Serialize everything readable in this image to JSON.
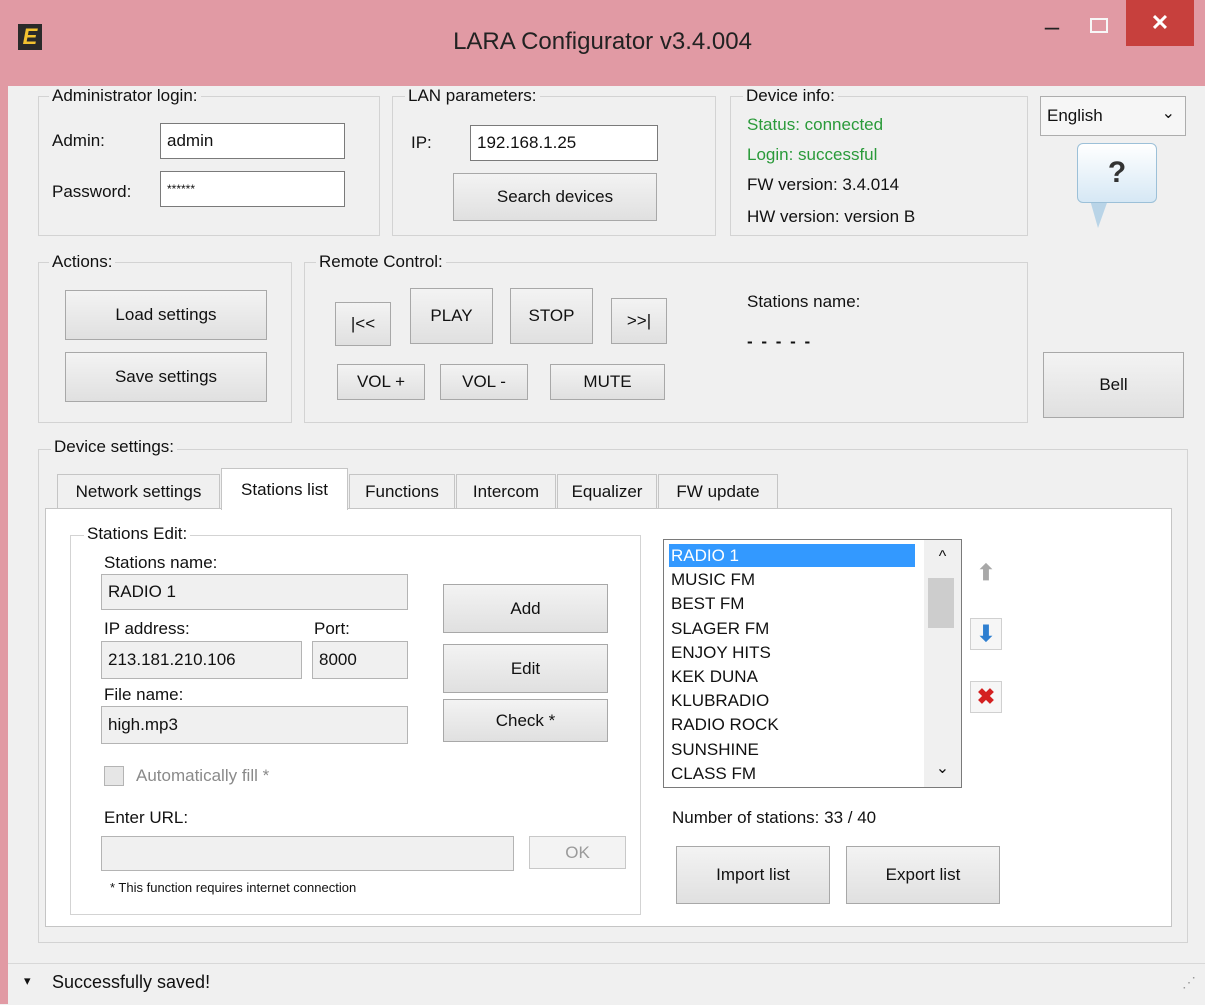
{
  "window": {
    "title": "LARA Configurator v3.4.004",
    "icon_letter": "E",
    "min_glyph": "–",
    "close_glyph": "✕"
  },
  "admin": {
    "group_title": "Administrator login:",
    "admin_label": "Admin:",
    "admin_value": "admin",
    "password_label": "Password:",
    "password_value": "******"
  },
  "lan": {
    "group_title": "LAN parameters:",
    "ip_label": "IP:",
    "ip_value": "192.168.1.25",
    "search_button": "Search devices"
  },
  "device_info": {
    "group_title": "Device info:",
    "status": "Status: connected",
    "login": "Login: successful",
    "fw_version": "FW version: 3.4.014",
    "hw_version": "HW version: version B"
  },
  "language": {
    "selected": "English",
    "chevron": "⌄"
  },
  "help": {
    "glyph": "?"
  },
  "actions": {
    "group_title": "Actions:",
    "load": "Load settings",
    "save": "Save settings"
  },
  "remote": {
    "group_title": "Remote Control:",
    "prev": "|<<",
    "play": "PLAY",
    "stop": "STOP",
    "next": ">>|",
    "vol_up": "VOL +",
    "vol_down": "VOL -",
    "mute": "MUTE",
    "stations_name_label": "Stations name:",
    "stations_name_value": "- - - - -"
  },
  "bell": "Bell",
  "device_settings": {
    "group_title": "Device settings:",
    "tabs": [
      "Network settings",
      "Stations list",
      "Functions",
      "Intercom",
      "Equalizer",
      "FW update"
    ]
  },
  "stations_edit": {
    "group_title": "Stations Edit:",
    "name_label": "Stations name:",
    "name_value": "RADIO 1",
    "ip_label": "IP address:",
    "ip_value": "213.181.210.106",
    "port_label": "Port:",
    "port_value": "8000",
    "file_label": "File name:",
    "file_value": "high.mp3",
    "add": "Add",
    "edit": "Edit",
    "check": "Check *",
    "autofill_label": "Automatically fill *",
    "url_label": "Enter URL:",
    "url_value": "",
    "ok": "OK",
    "note": "* This function requires internet connection"
  },
  "stations": {
    "items": [
      "RADIO 1",
      "MUSIC FM",
      "BEST FM",
      "SLAGER FM",
      "ENJOY HITS",
      "KEK DUNA",
      "KLUBRADIO",
      "RADIO ROCK",
      "SUNSHINE",
      "CLASS FM"
    ],
    "selected_index": 0,
    "count_text": "Number of stations: 33 / 40",
    "import": "Import list",
    "export": "Export list",
    "scroll_up": "^",
    "scroll_down": "⌄",
    "up_arrow": "⬆",
    "down_arrow": "⬇",
    "delete": "✖",
    "colors": {
      "selection": "#3399ff",
      "up_arrow": "#a8a8a8",
      "down_arrow": "#2f7fd0",
      "delete": "#d42020"
    }
  },
  "status_bar": {
    "arrow": "▾",
    "message": "Successfully saved!",
    "grip": "⋰"
  }
}
